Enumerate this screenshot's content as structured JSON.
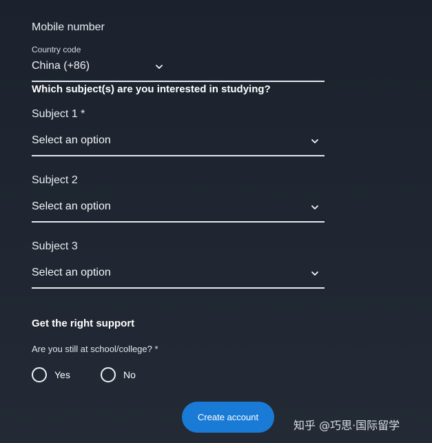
{
  "mobile": {
    "label": "Mobile number",
    "country_code_label": "Country code",
    "country_code_value": "China (+86)"
  },
  "subjects": {
    "question": "Which subject(s) are you interested in studying?",
    "items": [
      {
        "label": "Subject 1 *",
        "value": "Select an option"
      },
      {
        "label": "Subject 2",
        "value": "Select an option"
      },
      {
        "label": "Subject 3",
        "value": "Select an option"
      }
    ]
  },
  "support": {
    "title": "Get the right support",
    "question": "Are you still at school/college? *",
    "options": [
      "Yes",
      "No"
    ]
  },
  "actions": {
    "create_label": "Create account"
  },
  "watermark": {
    "text": "知乎 @巧思·国际留学"
  },
  "colors": {
    "background": "#1f2631",
    "button": "#1a7bd6",
    "underline": "#e6e9ee"
  },
  "icons": {
    "dropdown": "chevron-down-icon"
  }
}
